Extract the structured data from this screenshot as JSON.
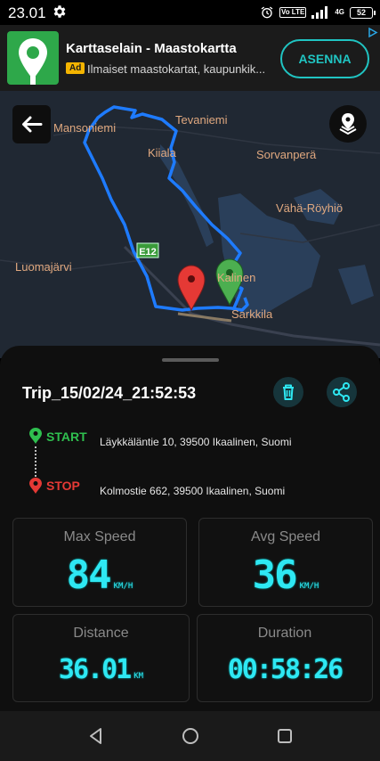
{
  "status": {
    "time": "23.01",
    "volte": "Vo LTE",
    "network": "4G",
    "battery": "52"
  },
  "ad": {
    "title": "Karttaselain - Maastokartta",
    "badge": "Ad",
    "subtitle": "Ilmaiset maastokartat, kaupunkik...",
    "cta": "ASENNA"
  },
  "map": {
    "labels": [
      "Mansoniemi",
      "Tevaniemi",
      "Kiiala",
      "Sorvanperä",
      "Vähä-Röyhiö",
      "Luomajärvi",
      "Kalinen",
      "Sarkkila"
    ],
    "road_label": "E12"
  },
  "trip": {
    "title": "Trip_15/02/24_21:52:53",
    "start_label": "START",
    "start_address": "Läykkäläntie 10, 39500 Ikaalinen, Suomi",
    "stop_label": "STOP",
    "stop_address": "Kolmostie 662, 39500 Ikaalinen, Suomi"
  },
  "stats": {
    "max_speed": {
      "label": "Max Speed",
      "value": "84",
      "unit": "KM/H"
    },
    "avg_speed": {
      "label": "Avg Speed",
      "value": "36",
      "unit": "KM/H"
    },
    "distance": {
      "label": "Distance",
      "value": "36.01",
      "unit": "KM"
    },
    "duration": {
      "label": "Duration",
      "value": "00:58:26"
    }
  },
  "colors": {
    "accent": "#2ee8f3",
    "start": "#2fbf4f",
    "stop": "#e53935",
    "route": "#1e7bff"
  }
}
